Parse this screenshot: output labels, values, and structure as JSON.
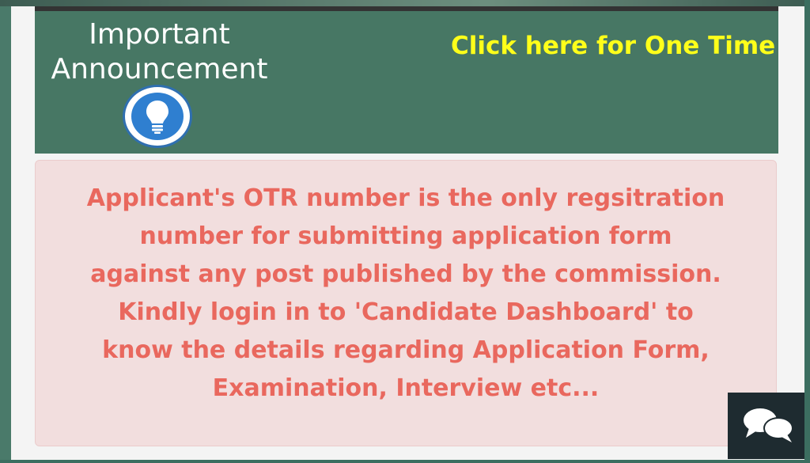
{
  "header": {
    "title_line1": "Important",
    "title_line2": "Announcement",
    "marquee_text": "Click here for One Time Registration",
    "bulb_icon": "lightbulb-icon",
    "marquee_color": "#ffff1a",
    "background_color": "#477764"
  },
  "alert": {
    "lines": [
      "Applicant's OTR number is the only regsitration",
      "number for submitting application form",
      "against any post published by the commission.",
      "Kindly login in to 'Candidate Dashboard' to",
      "know the details regarding Application Form,",
      "Examination, Interview etc..."
    ],
    "text_color": "#e9685e",
    "background_color": "#f2dede"
  },
  "chat": {
    "icon": "chat-bubbles-icon"
  }
}
